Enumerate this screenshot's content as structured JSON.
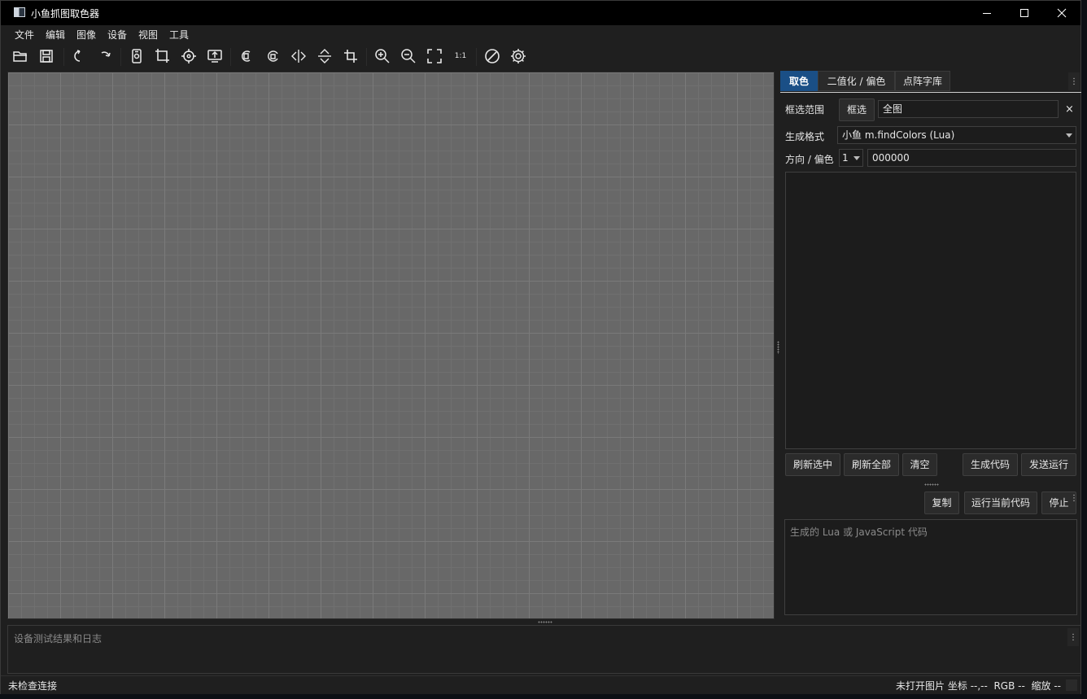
{
  "window": {
    "title": "小鱼抓图取色器",
    "controls": [
      "minimize-icon",
      "maximize-icon",
      "close-icon"
    ]
  },
  "menu": [
    "文件",
    "编辑",
    "图像",
    "设备",
    "视图",
    "工具"
  ],
  "toolbar": {
    "items": [
      {
        "icon": "open-folder-icon"
      },
      {
        "icon": "save-icon"
      },
      {
        "icon": "undo-icon"
      },
      {
        "icon": "redo-icon"
      },
      {
        "icon": "device-screenshot-icon"
      },
      {
        "icon": "crop-region-icon"
      },
      {
        "icon": "crosshair-icon"
      },
      {
        "icon": "upload-screen-icon"
      },
      {
        "icon": "rotate-left-icon"
      },
      {
        "icon": "rotate-right-icon"
      },
      {
        "icon": "flip-horizontal-icon"
      },
      {
        "icon": "flip-vertical-icon"
      },
      {
        "icon": "crop-icon"
      },
      {
        "icon": "zoom-in-icon"
      },
      {
        "icon": "zoom-out-icon"
      },
      {
        "icon": "fit-screen-icon"
      },
      {
        "icon": "actual-size-icon",
        "label": "1:1"
      },
      {
        "icon": "stop-icon"
      },
      {
        "icon": "settings-gear-icon"
      }
    ]
  },
  "panel": {
    "tabs": [
      {
        "label": "取色",
        "active": true
      },
      {
        "label": "二值化 / 偏色",
        "active": false
      },
      {
        "label": "点阵字库",
        "active": false
      }
    ],
    "range_label": "框选范围",
    "range_button": "框选",
    "range_value": "全图",
    "clear_range_symbol": "×",
    "format_label": "生成格式",
    "format_value": "小鱼 m.findColors (Lua)",
    "direction_label": "方向 / 偏色",
    "direction_value": "1",
    "offset_value": "000000",
    "buttons": {
      "refresh_selected": "刷新选中",
      "refresh_all": "刷新全部",
      "clear": "清空",
      "generate_code": "生成代码",
      "send_run": "发送运行"
    },
    "code_buttons": {
      "copy": "复制",
      "run_current": "运行当前代码",
      "stop": "停止"
    },
    "code_placeholder": "生成的 Lua 或 JavaScript 代码"
  },
  "log": {
    "placeholder": "设备测试结果和日志"
  },
  "status": {
    "connection": "未检查连接",
    "image_state": "未打开图片",
    "coord_label": "坐标",
    "coord_value": "--,--",
    "rgb_label": "RGB",
    "rgb_value": "--",
    "zoom_label": "缩放",
    "zoom_value": "--"
  },
  "colors": {
    "active_tab": "#1a4f86",
    "canvas": "#686868",
    "background": "#1f1f1f"
  }
}
